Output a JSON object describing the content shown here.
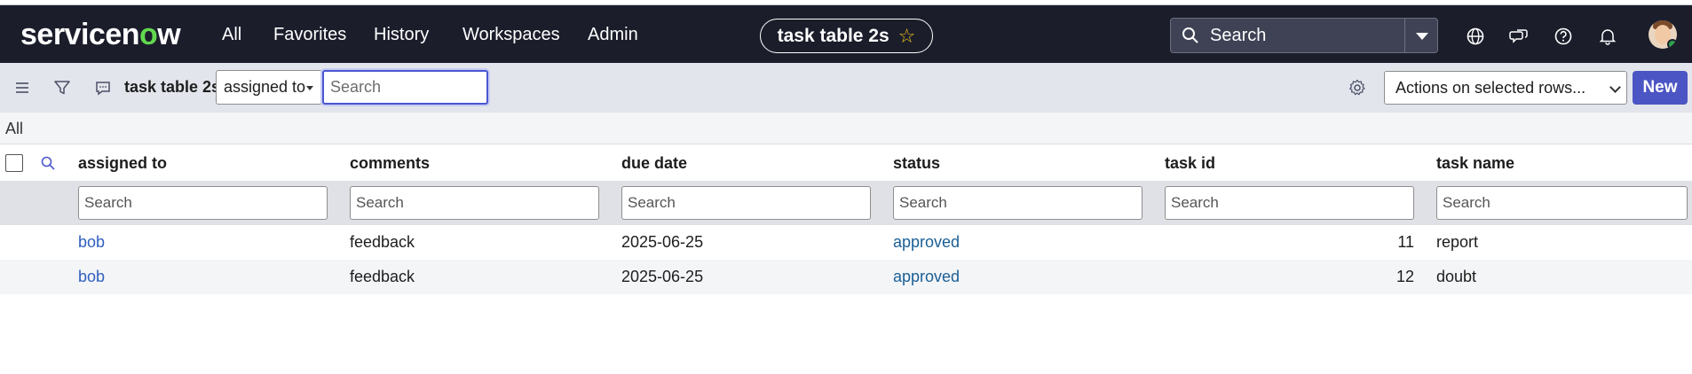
{
  "brand": {
    "logo_pre": "servicen",
    "logo_o": "o",
    "logo_post": "w"
  },
  "nav": [
    "All",
    "Favorites",
    "History",
    "Workspaces",
    "Admin"
  ],
  "context_pill": {
    "title": "task table 2s"
  },
  "global_search": {
    "placeholder": "Search"
  },
  "toolbar": {
    "list_title": "task table 2s",
    "field_select": "assigned to",
    "search_placeholder": "Search",
    "actions_label": "Actions on selected rows...",
    "new_label": "New"
  },
  "breadcrumb": "All",
  "columns": [
    "assigned to",
    "comments",
    "due date",
    "status",
    "task id",
    "task name"
  ],
  "column_search_placeholder": "Search",
  "rows": [
    {
      "assigned_to": "bob",
      "comments": "feedback",
      "due_date": "2025-06-25",
      "status": "approved",
      "task_id": "11",
      "task_name": "report"
    },
    {
      "assigned_to": "bob",
      "comments": "feedback",
      "due_date": "2025-06-25",
      "status": "approved",
      "task_id": "12",
      "task_name": "doubt"
    }
  ],
  "colors": {
    "nav_bg": "#1b1d2b",
    "accent": "#4c55c4",
    "logo_green": "#62d84e",
    "link": "#2f5fbf"
  }
}
